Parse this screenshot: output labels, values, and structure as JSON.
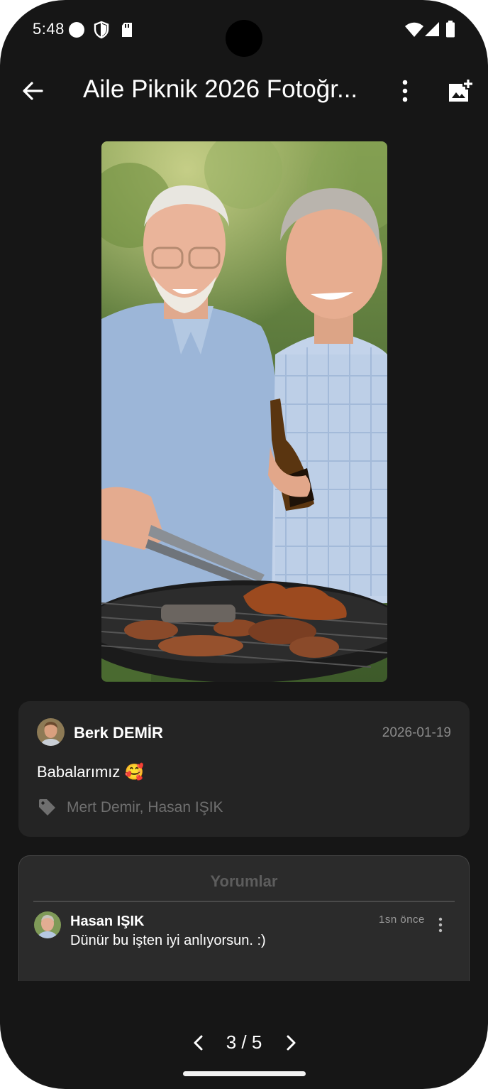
{
  "status_bar": {
    "time": "5:48",
    "left_icons": [
      "circle-notification-icon",
      "shield-icon",
      "sd-card-icon"
    ],
    "right_icons": [
      "wifi-icon",
      "cell-signal-icon",
      "battery-icon"
    ]
  },
  "app_bar": {
    "back_icon": "arrow-back-icon",
    "title": "Aile Piknik 2026 Fotoğr...",
    "more_icon": "more-vert-icon",
    "add_icon": "add-photo-icon"
  },
  "photo": {
    "description_icon": "photo-image"
  },
  "post": {
    "author": "Berk DEMİR",
    "date": "2026-01-19",
    "caption": "Babalarımız 🥰",
    "tag_icon": "tag-icon",
    "tags": "Mert Demir, Hasan IŞIK"
  },
  "comments": {
    "title": "Yorumlar",
    "items": [
      {
        "name": "Hasan IŞIK",
        "time": "1sn önce",
        "text": "Dünür bu işten iyi anlıyorsun. :)"
      }
    ]
  },
  "pager": {
    "text": "3 / 5"
  },
  "colors": {
    "background": "#161616",
    "card": "#242424",
    "comments_panel": "#2b2b2b",
    "text": "#ffffff",
    "muted": "#8b8b8b"
  }
}
